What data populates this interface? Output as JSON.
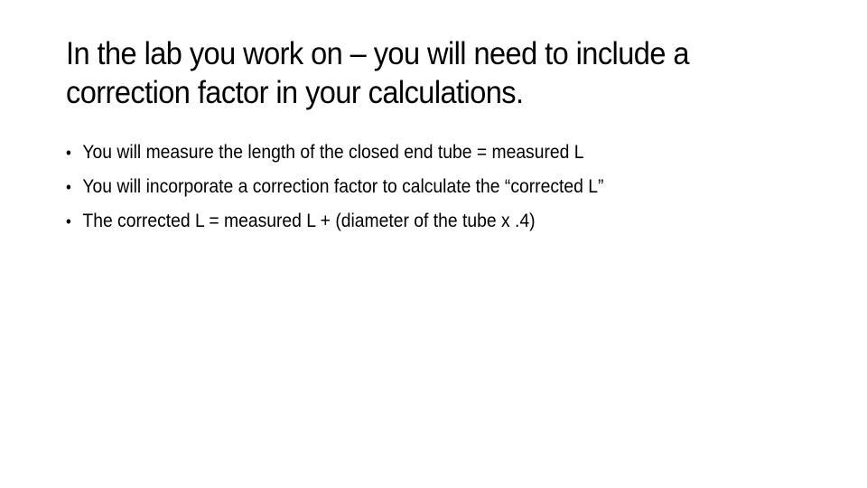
{
  "slide": {
    "title": "In the lab you work on – you will need to include a correction factor in your calculations.",
    "bullet_glyph": "•",
    "bullets": [
      {
        "text": "You will measure the length of the closed end tube = measured L"
      },
      {
        "text": "You will incorporate a correction factor to calculate the “corrected L”"
      },
      {
        "text": "The corrected L = measured L + (diameter of the tube x .4)"
      }
    ]
  }
}
